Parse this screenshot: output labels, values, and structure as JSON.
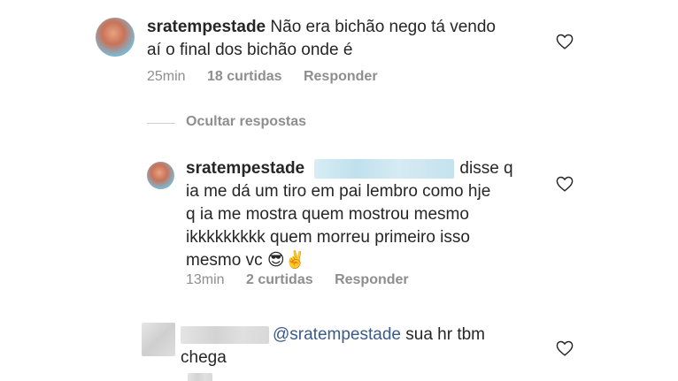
{
  "comment": {
    "username": "sratempestade",
    "text": "Não era bichão nego tá vendo aí o final dos bichão onde é",
    "line1": "Não era bichão nego tá vendo",
    "line2": "aí o final dos bichão onde é",
    "time": "25min",
    "likes": "18 curtidas",
    "reply_label": "Responder",
    "like_icon": "heart-outline-icon"
  },
  "hide_replies_label": "Ocultar respostas",
  "reply1": {
    "username": "sratempestade",
    "mention_redacted": true,
    "line1": "disse q",
    "line2": "ia me dá um tiro em pai lembro como hje",
    "line3": "q ia me mostra quem mostrou mesmo",
    "line4": "ikkkkkkkkk quem morreu primeiro isso",
    "line5": "mesmo vc 😎✌️",
    "time": "13min",
    "likes": "2 curtidas",
    "reply_label": "Responder",
    "like_icon": "heart-outline-icon"
  },
  "reply2": {
    "username_redacted": true,
    "mention": "@sratempestade",
    "line1": "sua hr tbm",
    "line2": "chega",
    "like_icon": "heart-outline-icon"
  },
  "colors": {
    "text": "#262626",
    "meta": "#8e8e8e",
    "mention": "#3a5a8a",
    "redaction_blue": "#c4e2ef",
    "redaction_grey": "#d8d8d8"
  }
}
